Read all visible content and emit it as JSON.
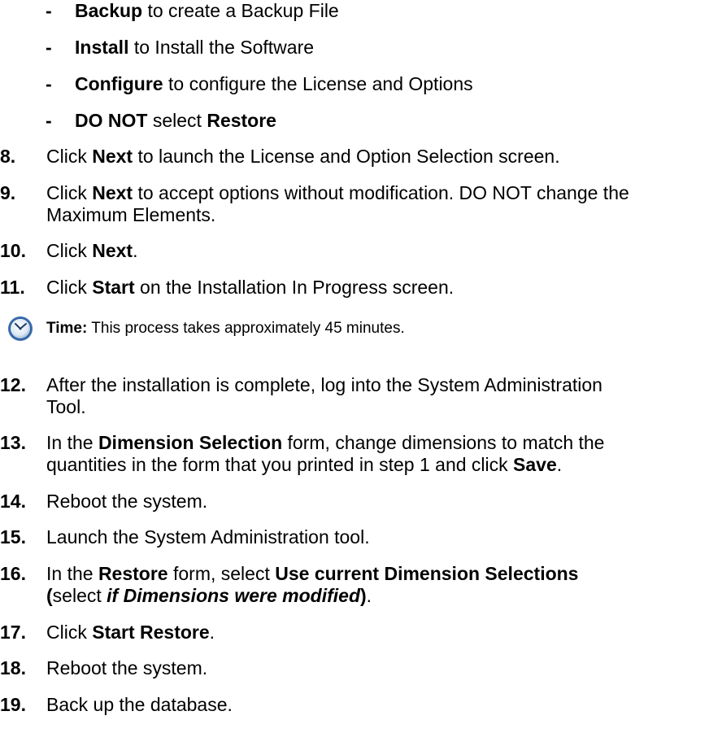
{
  "options": [
    {
      "bold": "Backup",
      "rest": " to create a Backup File"
    },
    {
      "bold": "Install",
      "rest": " to Install the Software"
    },
    {
      "bold": "Configure",
      "rest": " to configure the License and Options"
    },
    {
      "bold": "DO NOT",
      "mid": " select ",
      "bold2": "Restore"
    }
  ],
  "dash": "-",
  "steps": {
    "s8": {
      "num": "8.",
      "a": "Click ",
      "b": "Next",
      "c": " to launch the License and Option Selection screen."
    },
    "s9": {
      "num": "9.",
      "a": "Click ",
      "b": "Next",
      "c": " to accept options without modification. DO NOT change the",
      "line2": "Maximum Elements."
    },
    "s10": {
      "num": "10.",
      "a": "Click ",
      "b": "Next",
      "c": "."
    },
    "s11": {
      "num": "11.",
      "a": "Click ",
      "b": "Start",
      "c": " on the Installation In Progress screen."
    },
    "s12": {
      "num": "12.",
      "line1": "After the installation is complete, log into the System Administration",
      "line2": "Tool."
    },
    "s13": {
      "num": "13.",
      "a": "In the ",
      "b": "Dimension Selection",
      "c": " form, change dimensions to match the",
      "line2a": "quantities in the form that you printed in step 1 and click ",
      "line2b": "Save",
      "line2c": "."
    },
    "s14": {
      "num": "14.",
      "text": "Reboot the system."
    },
    "s15": {
      "num": "15.",
      "text": "Launch the System Administration tool."
    },
    "s16": {
      "num": "16.",
      "a": "In the ",
      "b": "Restore",
      "c": " form, select ",
      "d": "Use current Dimension Selections",
      "line2a": "(",
      "line2b": "select ",
      "line2c": "if Dimensions were modified",
      "line2d": ")",
      "line2e": "."
    },
    "s17": {
      "num": "17.",
      "a": "Click ",
      "b": "Start Restore",
      "c": "."
    },
    "s18": {
      "num": "18.",
      "text": "Reboot the system."
    },
    "s19": {
      "num": "19.",
      "text": "Back up the database."
    }
  },
  "note": {
    "icon": "clock-icon",
    "label": "Time:",
    "text": " This process takes approximately 45 minutes."
  }
}
